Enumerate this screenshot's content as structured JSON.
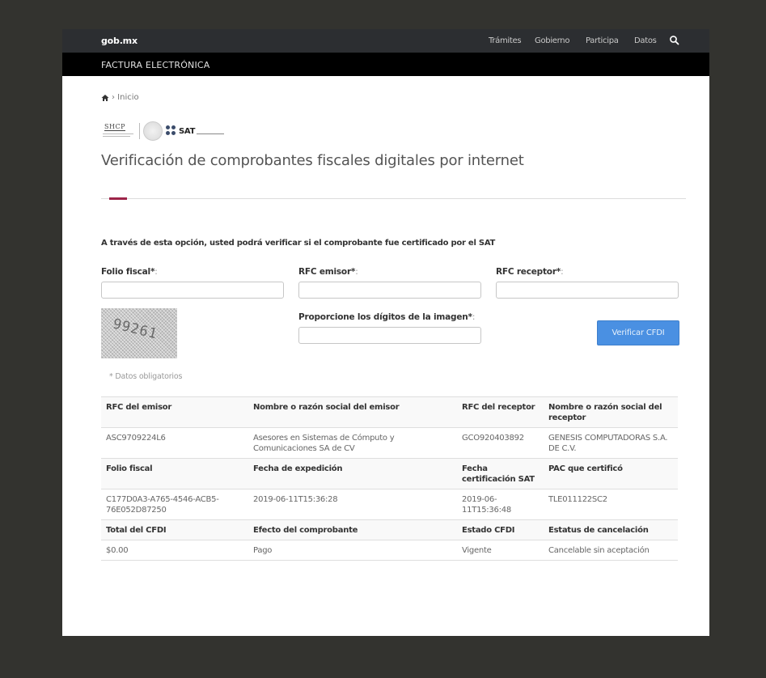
{
  "header": {
    "brand": "gob.mx",
    "nav": [
      "Trámites",
      "Gobierno",
      "Participa",
      "Datos"
    ],
    "subtitle": "FACTURA ELECTRÓNICA"
  },
  "breadcrumb": {
    "label": "› Inicio"
  },
  "logos": {
    "shcp": "SHCP",
    "sat": "SAT"
  },
  "page_title": "Verificación de comprobantes fiscales digitales por internet",
  "form": {
    "intro": "A través de esta opción, usted podrá verificar si el comprobante fue certificado por el SAT",
    "folio_label": "Folio fiscal*",
    "folio_value": "",
    "rfc_emisor_label": "RFC emisor*",
    "rfc_emisor_value": "",
    "rfc_receptor_label": "RFC receptor*",
    "rfc_receptor_value": "",
    "captcha_label": "Proporcione los dígitos de la imagen*",
    "captcha_value": "",
    "captcha_image_text": "99261",
    "label_suffix": ":",
    "verify_button": "Verificar CFDI",
    "required_note": "* Datos obligatorios"
  },
  "results": {
    "rows": [
      {
        "type": "header",
        "cells": [
          "RFC del emisor",
          "Nombre o razón social del emisor",
          "RFC del receptor",
          "Nombre o razón social del receptor"
        ]
      },
      {
        "type": "value",
        "cells": [
          "ASC9709224L6",
          "Asesores en Sistemas de Cómputo y Comunicaciones SA de CV",
          "GCO920403892",
          "GENESIS COMPUTADORAS S.A. DE C.V."
        ]
      },
      {
        "type": "header",
        "cells": [
          "Folio fiscal",
          "Fecha de expedición",
          "Fecha certificación SAT",
          "PAC que certificó"
        ]
      },
      {
        "type": "value",
        "cells": [
          "C177D0A3-A765-4546-ACB5-76E052D87250",
          "2019-06-11T15:36:28",
          "2019-06-11T15:36:48",
          "TLE011122SC2"
        ]
      },
      {
        "type": "header",
        "cells": [
          "Total del CFDI",
          "Efecto del comprobante",
          "Estado CFDI",
          "Estatus de cancelación"
        ]
      },
      {
        "type": "value",
        "cells": [
          "$0.00",
          "Pago",
          "Vigente",
          "Cancelable sin aceptación"
        ]
      }
    ]
  },
  "colors": {
    "topbar": "#2c2e31",
    "subbar": "#000000",
    "accent": "#9d2449",
    "button": "#4a90e2",
    "backdrop": "#33332f"
  },
  "icons": {
    "home": "home-icon",
    "search": "search-icon"
  }
}
